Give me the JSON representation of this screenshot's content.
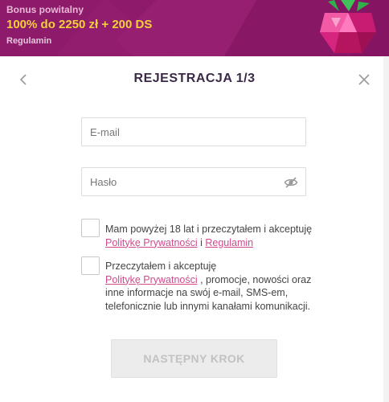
{
  "banner": {
    "title": "Bonus powitalny",
    "offer": "100% do 2250 zł + 200 DS",
    "terms_link": "Regulamin",
    "background_color": "#8e1a6b",
    "offer_color": "#f3d13b",
    "icon": "raspberry-gem-icon"
  },
  "modal": {
    "title": "REJESTRACJA 1/3",
    "back_icon": "chevron-left-icon",
    "close_icon": "close-icon"
  },
  "form": {
    "email": {
      "placeholder": "E-mail",
      "value": ""
    },
    "password": {
      "placeholder": "Hasło",
      "value": "",
      "icon": "eye-slash-icon"
    },
    "consents": [
      {
        "checked": false,
        "text_before": "Mam powyżej 18 lat i przeczytałem i akceptuję ",
        "link1": "Politykę Prywatności",
        "text_between": " i ",
        "link2": "Regulamin"
      },
      {
        "checked": false,
        "text_before": "Przeczytałem i akceptuję",
        "link1": "Politykę Prywatności",
        "text_after": " , promocje, nowości oraz inne informacje na swój e-mail, SMS-em, telefonicznie lub innymi kanałami komunikacji."
      }
    ],
    "next_button": "NASTĘPNY KROK",
    "link_color": "#d04a8d"
  }
}
